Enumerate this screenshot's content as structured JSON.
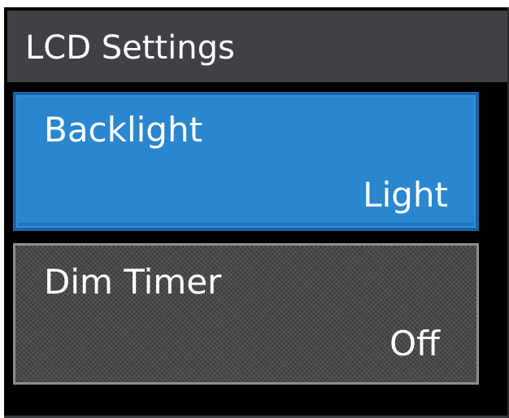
{
  "header": {
    "title": "LCD Settings"
  },
  "items": [
    {
      "label": "Backlight",
      "value": "Light",
      "selected": true
    },
    {
      "label": "Dim Timer",
      "value": "Off",
      "selected": false
    }
  ],
  "colors": {
    "header_bg": "#3f4146",
    "selected_bg": "#2a86ce",
    "selected_border": "#1a64a8",
    "tile_bg": "#474849",
    "tile_border": "#8c8d90",
    "text": "#ffffff",
    "screen_bg": "#000000"
  }
}
